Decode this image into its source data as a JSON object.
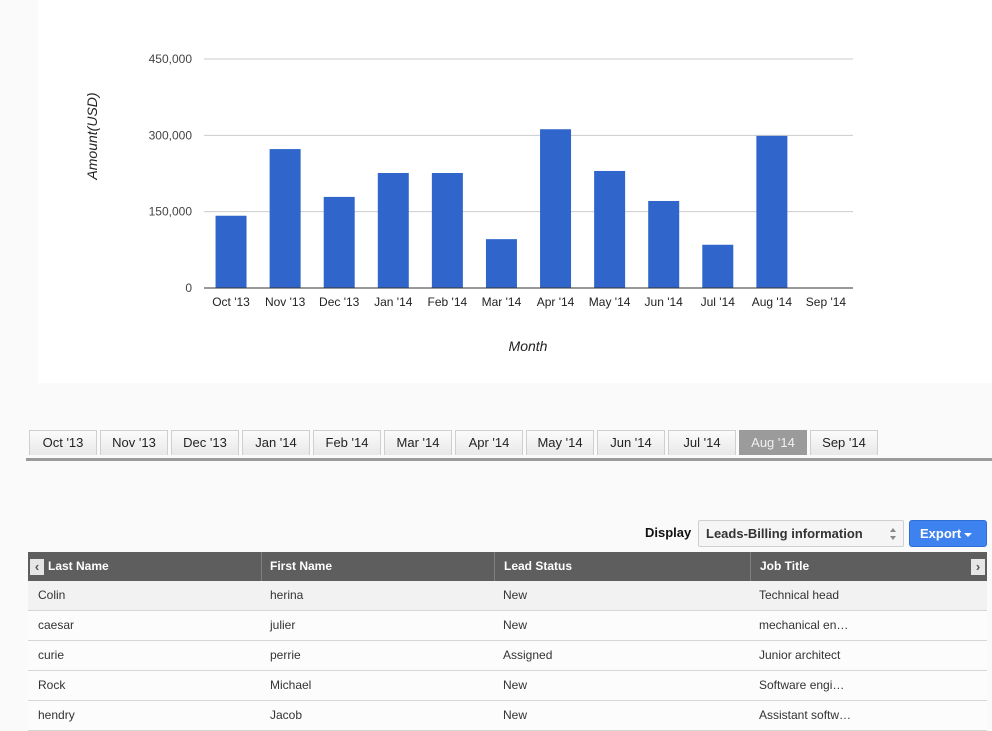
{
  "chart_data": {
    "type": "bar",
    "title": "",
    "xlabel": "Month",
    "ylabel": "Amount(USD)",
    "categories": [
      "Oct '13",
      "Nov '13",
      "Dec '13",
      "Jan '14",
      "Feb '14",
      "Mar '14",
      "Apr '14",
      "May '14",
      "Jun '14",
      "Jul '14",
      "Aug '14",
      "Sep '14"
    ],
    "values": [
      142000,
      273000,
      179000,
      226000,
      226000,
      96000,
      312000,
      230000,
      171000,
      85000,
      299000,
      0
    ],
    "ylim": [
      0,
      450000
    ],
    "yticks": [
      0,
      150000,
      300000,
      450000
    ],
    "ytick_labels": [
      "0",
      "150,000",
      "300,000",
      "450,000"
    ],
    "grid": true,
    "legend": "none",
    "bar_color": "#3066cc"
  },
  "tabs": {
    "items": [
      "Oct '13",
      "Nov '13",
      "Dec '13",
      "Jan '14",
      "Feb '14",
      "Mar '14",
      "Apr '14",
      "May '14",
      "Jun '14",
      "Jul '14",
      "Aug '14",
      "Sep '14"
    ],
    "active": "Aug '14"
  },
  "toolbar": {
    "display_label": "Display",
    "display_value": "Leads-Billing information",
    "export_label": "Export"
  },
  "grid": {
    "columns": [
      "Last Name",
      "First Name",
      "Lead Status",
      "Job Title"
    ],
    "rows": [
      [
        "Colin",
        "herina",
        "New",
        "Technical head"
      ],
      [
        "caesar",
        "julier",
        "New",
        "mechanical en…"
      ],
      [
        "curie",
        "perrie",
        "Assigned",
        "Junior architect"
      ],
      [
        "Rock",
        "Michael",
        "New",
        "Software engi…"
      ],
      [
        "hendry",
        "Jacob",
        "New",
        "Assistant softw…"
      ]
    ],
    "scroll_left_icon": "‹",
    "scroll_right_icon": "›"
  },
  "colors": {
    "accent": "#3e82f0",
    "header_bg": "#5e5e5e",
    "active_tab": "#9b9b9b"
  }
}
